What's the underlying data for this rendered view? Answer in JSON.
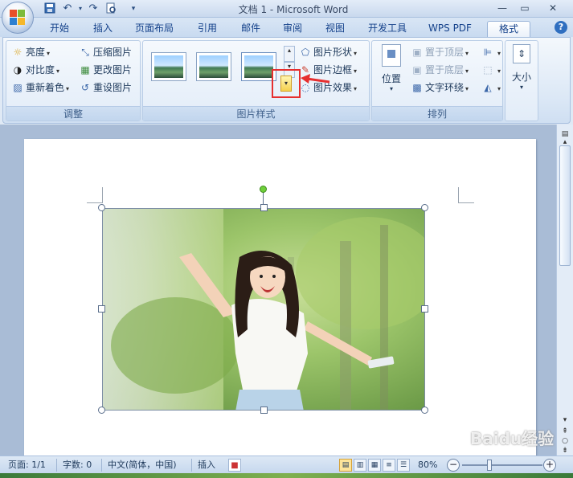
{
  "window": {
    "title": "文档 1 - Microsoft Word",
    "controls": [
      "minimize",
      "maximize",
      "close"
    ]
  },
  "quick_access": {
    "save_icon": "save-icon",
    "undo_icon": "undo-icon",
    "redo_icon": "redo-icon",
    "print_preview_icon": "print-preview-icon"
  },
  "tabs": [
    {
      "label": "开始"
    },
    {
      "label": "插入"
    },
    {
      "label": "页面布局"
    },
    {
      "label": "引用"
    },
    {
      "label": "邮件"
    },
    {
      "label": "审阅"
    },
    {
      "label": "视图"
    },
    {
      "label": "开发工具"
    },
    {
      "label": "WPS PDF"
    },
    {
      "label": "格式",
      "active": true
    }
  ],
  "help": "?",
  "ribbon": {
    "adjust": {
      "label": "调整",
      "brightness": "亮度",
      "contrast": "对比度",
      "recolor": "重新着色",
      "compress": "压缩图片",
      "change": "更改图片",
      "reset": "重设图片"
    },
    "styles": {
      "label": "图片样式",
      "shape": "图片形状",
      "border": "图片边框",
      "effects": "图片效果"
    },
    "arrange": {
      "label": "排列",
      "position": "位置",
      "bring_front": "置于顶层",
      "send_back": "置于底层",
      "text_wrap": "文字环绕"
    },
    "size": {
      "label": "大小"
    }
  },
  "statusbar": {
    "page": "页面: 1/1",
    "words": "字数: 0",
    "language": "中文(简体，中国)",
    "mode": "插入",
    "zoom": "80%"
  },
  "watermark": "Baidu经验",
  "colors": {
    "accent": "#15428b",
    "highlight": "#e62f2f",
    "ribbon_bg": "#dce8f6"
  }
}
